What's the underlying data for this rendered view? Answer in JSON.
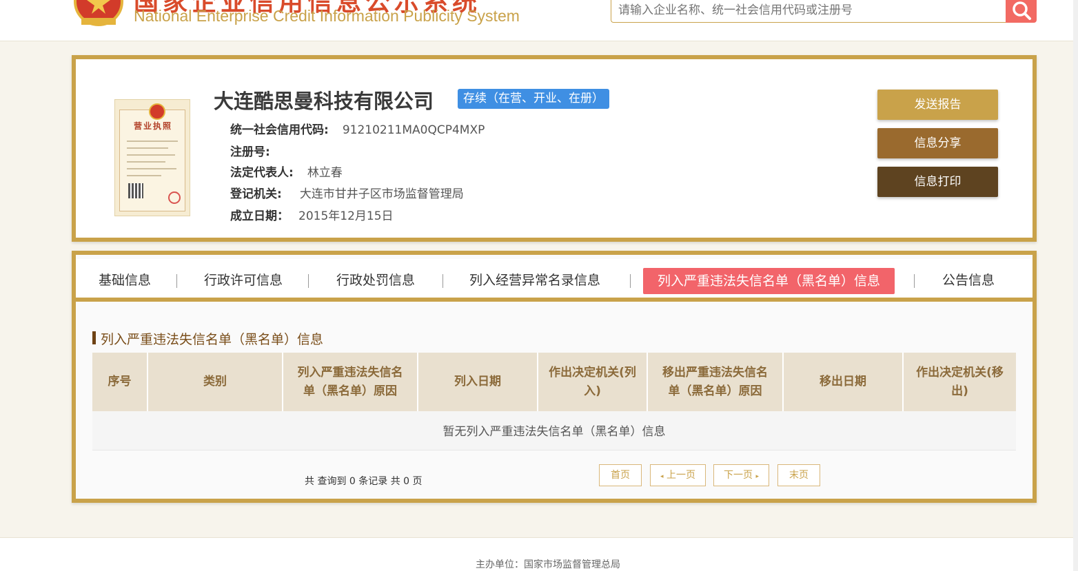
{
  "header": {
    "title_cn": "国家企业信用信息公示系统",
    "title_en": "National Enterprise Credit Information Publicity System",
    "search_placeholder": "请输入企业名称、统一社会信用代码或注册号"
  },
  "company": {
    "name": "大连酷思曼科技有限公司",
    "status": "存续（在营、开业、在册）",
    "license_title": "营业执照",
    "fields": [
      {
        "label": "统一社会信用代码:",
        "value": "91210211MA0QCP4MXP"
      },
      {
        "label": "注册号:",
        "value": ""
      },
      {
        "label": "法定代表人:",
        "value": "林立春"
      },
      {
        "label": "登记机关:",
        "value": "大连市甘井子区市场监督管理局"
      },
      {
        "label": "成立日期：",
        "value": "2015年12月15日"
      }
    ]
  },
  "actions": {
    "send_report": "发送报告",
    "share": "信息分享",
    "print": "信息打印"
  },
  "tabs": [
    {
      "label": "基础信息"
    },
    {
      "label": "行政许可信息"
    },
    {
      "label": "行政处罚信息"
    },
    {
      "label": "列入经营异常名录信息"
    },
    {
      "label": "列入严重违法失信名单（黑名单）信息"
    },
    {
      "label": "公告信息"
    }
  ],
  "section": {
    "title": "列入严重违法失信名单（黑名单）信息",
    "columns": [
      "序号",
      "类别",
      "列入严重违法失信名单（黑名单）原因",
      "列入日期",
      "作出决定机关(列入)",
      "移出严重违法失信名单（黑名单）原因",
      "移出日期",
      "作出决定机关(移出)"
    ],
    "empty_text": "暂无列入严重违法失信名单（黑名单）信息"
  },
  "pagination": {
    "summary": "共 查询到 0 条记录 共 0 页",
    "first": "首页",
    "prev": "上一页",
    "next": "下一页",
    "last": "末页"
  },
  "footer": {
    "text": "主办单位：国家市场监督管理总局"
  },
  "colors": {
    "gold": "#c9a24a",
    "status_blue": "#3f8fe3",
    "active_tab": "#f2646a",
    "btn_send": "#c9a24a",
    "btn_share": "#9a6a2e",
    "btn_print": "#5e4320"
  }
}
